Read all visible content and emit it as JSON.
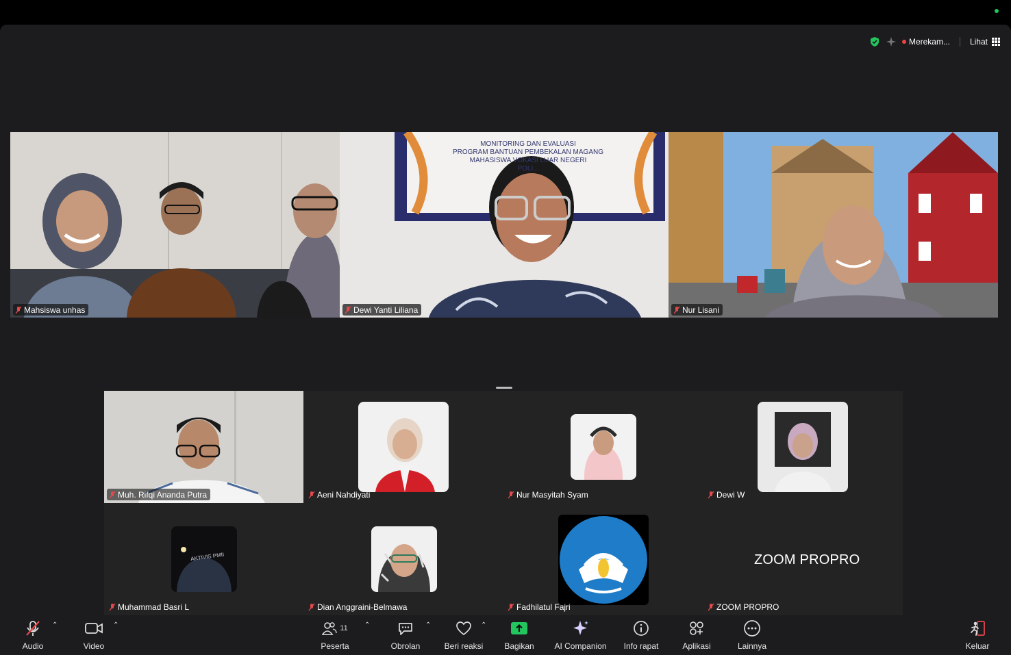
{
  "status": {
    "recording_label": "Merekam...",
    "view_label": "Lihat",
    "colors": {
      "shield": "#22c55e",
      "record": "#ef4444"
    }
  },
  "gallery_top": [
    {
      "name": "Mahsiswa unhas",
      "muted": true
    },
    {
      "name": "Dewi Yanti Liliana",
      "muted": true,
      "banner": [
        "MONITORING DAN EVALUASI",
        "PROGRAM BANTUAN PEMBEKALAN MAGANG",
        "MAHASISWA VOKASI LUAR NEGERI",
        "POLI..."
      ]
    },
    {
      "name": "Nur Lisani",
      "muted": true
    }
  ],
  "gallery_bottom": [
    {
      "name": "Muh. Rifqi Ananda Putra",
      "muted": true,
      "video": true
    },
    {
      "name": "Aeni Nahdiyati",
      "muted": true
    },
    {
      "name": "Nur Masyitah Syam",
      "muted": true
    },
    {
      "name": "Dewi W",
      "muted": true
    },
    {
      "name": "Muhammad Basri L",
      "muted": true,
      "jacket_text": "AKTIVIS PMII"
    },
    {
      "name": "Dian Anggraini-Belmawa",
      "muted": true
    },
    {
      "name": "Fadhilatul Fajri",
      "muted": true,
      "logo_text": "TUT WURI HANDAYANI"
    },
    {
      "name": "ZOOM PROPRO",
      "muted": true,
      "placeholder_text": "ZOOM PROPRO"
    }
  ],
  "toolbar": {
    "audio": "Audio",
    "video": "Video",
    "participants": "Peserta",
    "participants_count": "11",
    "chat": "Obrolan",
    "react": "Beri reaksi",
    "share": "Bagikan",
    "ai": "AI Companion",
    "info": "Info rapat",
    "apps": "Aplikasi",
    "more": "Lainnya",
    "leave": "Keluar",
    "colors": {
      "share": "#22c55e",
      "muted_mic": "#e5484d",
      "leave": "#e5484d"
    }
  }
}
